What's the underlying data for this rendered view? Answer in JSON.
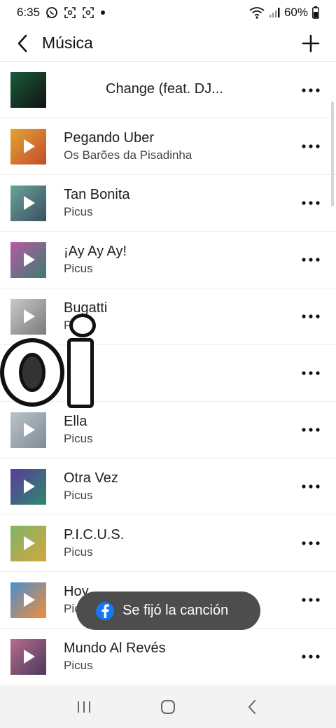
{
  "status_bar": {
    "time": "6:35",
    "battery": "60%",
    "icons": [
      "whatsapp-icon",
      "screenshot-icon",
      "screenshot-icon",
      "dot-icon",
      "wifi-icon",
      "signal-icon",
      "battery-icon"
    ]
  },
  "header": {
    "title": "Música",
    "back_icon": "chevron-left-icon",
    "add_icon": "plus-icon"
  },
  "songs": [
    {
      "title": "Change (feat. DJ...",
      "artist": "",
      "art_color": "#1a5c3a",
      "art_color2": "#111111"
    },
    {
      "title": "Pegando Uber",
      "artist": "Os Barões da Pisadinha",
      "art_color": "#e1a534",
      "art_color2": "#c54a2a"
    },
    {
      "title": "Tan Bonita",
      "artist": "Picus",
      "art_color": "#6aa39a",
      "art_color2": "#3c4f5f"
    },
    {
      "title": "¡Ay Ay Ay!",
      "artist": "Picus",
      "art_color": "#b55aa8",
      "art_color2": "#3f7c6a"
    },
    {
      "title": "Bugatti",
      "artist": "Picus",
      "art_color": "#c9c9c9",
      "art_color2": "#7a7a7a"
    },
    {
      "title": "",
      "artist": "",
      "art_color": "#9a9a9a",
      "art_color2": "#555555"
    },
    {
      "title": "Ella",
      "artist": "Picus",
      "art_color": "#b9c3c8",
      "art_color2": "#7e8d96"
    },
    {
      "title": "Otra Vez",
      "artist": "Picus",
      "art_color": "#5b3a9c",
      "art_color2": "#2c8a6b"
    },
    {
      "title": "P.I.C.U.S.",
      "artist": "Picus",
      "art_color": "#7fb46a",
      "art_color2": "#d4a63a"
    },
    {
      "title": "Hoy",
      "artist": "Picus",
      "art_color": "#4a8fcf",
      "art_color2": "#f08d3a"
    },
    {
      "title": "Mundo Al Revés",
      "artist": "Picus",
      "art_color": "#b56b8f",
      "art_color2": "#4b3a5a"
    }
  ],
  "toast": {
    "text": "Se fijó la canción",
    "icon": "facebook-icon"
  },
  "nav_bar": {
    "icons": [
      "recent-apps-icon",
      "home-icon",
      "back-icon"
    ]
  },
  "colors": {
    "accent": "#1877f2",
    "toast_bg": "#4d4d4d"
  }
}
